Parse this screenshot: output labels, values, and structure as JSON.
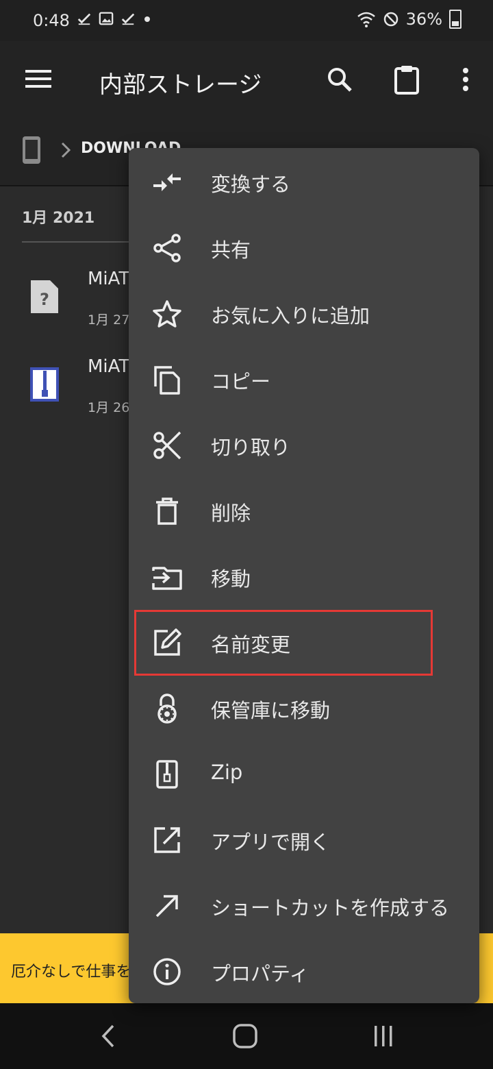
{
  "status": {
    "time": "0:48",
    "battery": "36%"
  },
  "appbar": {
    "title": "内部ストレージ"
  },
  "breadcrumb": {
    "folder": "DOWNLOAD"
  },
  "list": {
    "section": "1月 2021",
    "files": [
      {
        "name": "MiAT",
        "date": "1月 27",
        "icon": "unknown-file-icon"
      },
      {
        "name": "MiAT",
        "date": "1月 26",
        "icon": "zip-file-icon"
      }
    ]
  },
  "banner": {
    "text": "厄介なしで仕事を"
  },
  "menu": {
    "items": [
      {
        "label": "変換する",
        "icon": "convert-icon"
      },
      {
        "label": "共有",
        "icon": "share-icon"
      },
      {
        "label": "お気に入りに追加",
        "icon": "star-icon"
      },
      {
        "label": "コピー",
        "icon": "copy-icon"
      },
      {
        "label": "切り取り",
        "icon": "scissors-icon"
      },
      {
        "label": "削除",
        "icon": "trash-icon"
      },
      {
        "label": "移動",
        "icon": "move-icon"
      },
      {
        "label": "名前変更",
        "icon": "rename-icon"
      },
      {
        "label": "保管庫に移動",
        "icon": "lock-icon"
      },
      {
        "label": "Zip",
        "icon": "zip-icon"
      },
      {
        "label": "アプリで開く",
        "icon": "open-external-icon"
      },
      {
        "label": "ショートカットを作成する",
        "icon": "shortcut-icon"
      },
      {
        "label": "プロパティ",
        "icon": "info-icon"
      }
    ]
  },
  "colors": {
    "highlight": "#e53935",
    "banner": "#fdc82f",
    "menu_bg": "#424242"
  }
}
